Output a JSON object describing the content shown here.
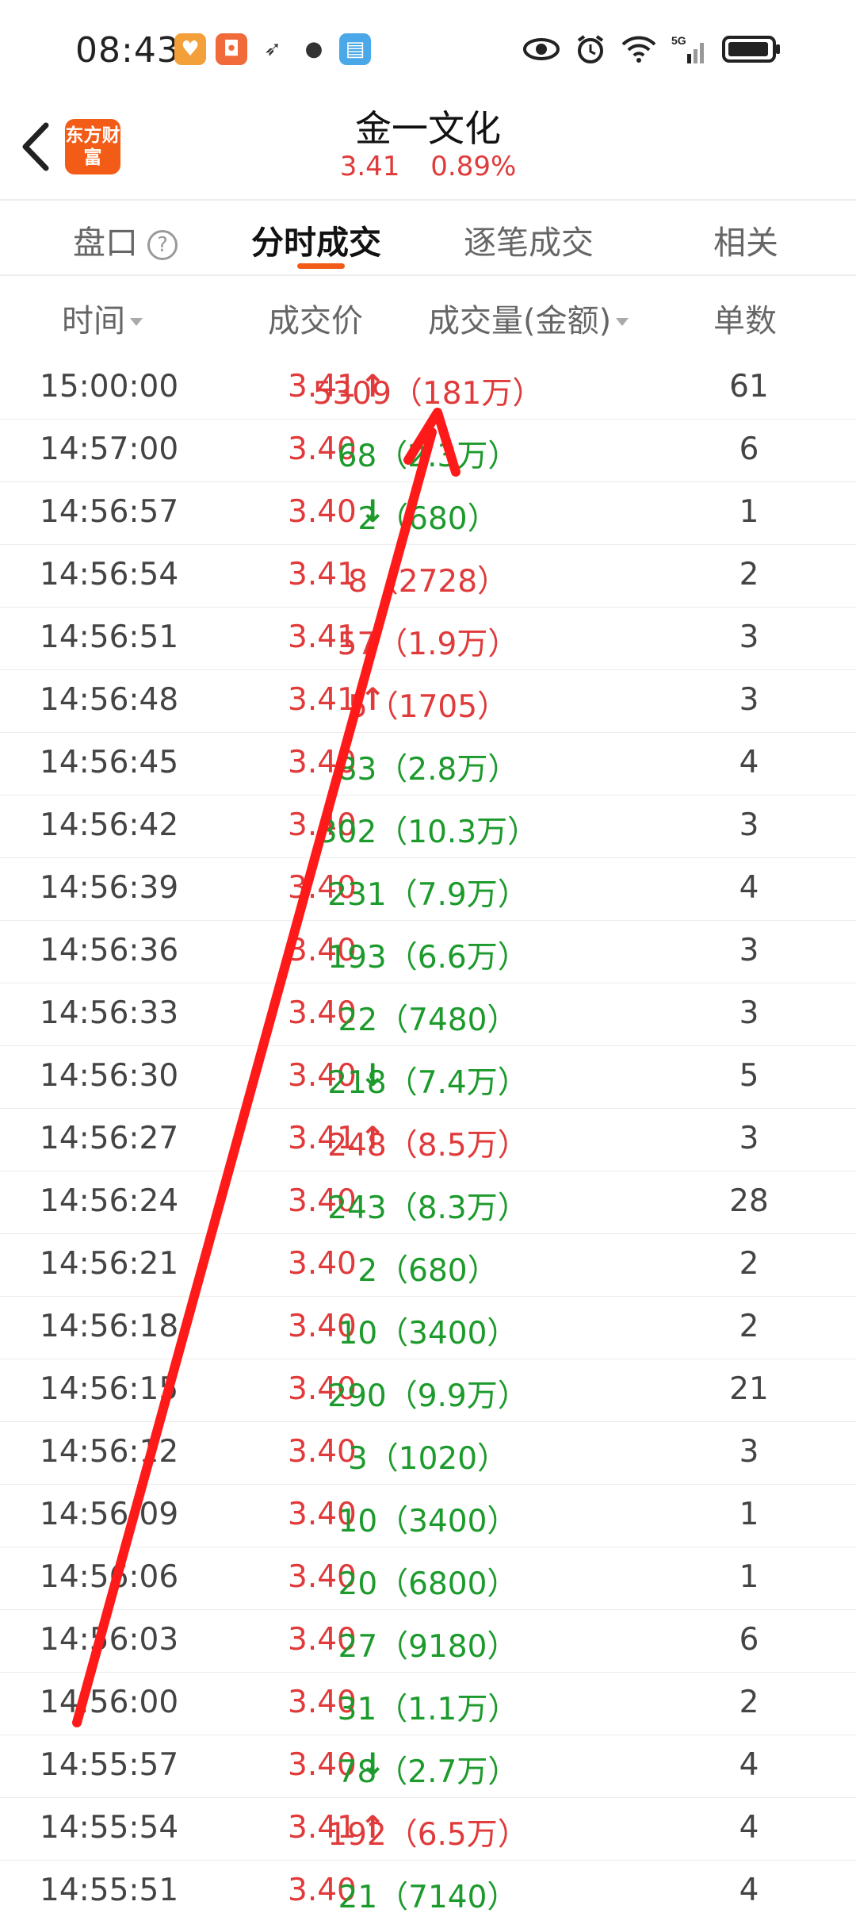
{
  "status_bar": {
    "time": "08:43",
    "network": "5G"
  },
  "header": {
    "title": "金一文化",
    "logo_text": "东方财富",
    "price": "3.41",
    "change_pct": "0.89%"
  },
  "tabs": [
    {
      "label": "盘口",
      "active": false
    },
    {
      "label": "分时成交",
      "active": true
    },
    {
      "label": "逐笔成交",
      "active": false
    },
    {
      "label": "相关",
      "active": false
    }
  ],
  "columns": {
    "time": "时间",
    "price": "成交价",
    "volume": "成交量(金额)",
    "count": "单数"
  },
  "colors": {
    "up": "#e03a3a",
    "down": "#1c9a2c",
    "brand": "#f25c17"
  },
  "rows": [
    {
      "time": "15:00:00",
      "price": "3.41",
      "arrow": "↑",
      "volume": "5309（181万）",
      "vol_color": "red",
      "count": "61"
    },
    {
      "time": "14:57:00",
      "price": "3.40",
      "arrow": "",
      "volume": "68（2.3万）",
      "vol_color": "green",
      "count": "6"
    },
    {
      "time": "14:56:57",
      "price": "3.40",
      "arrow": "↓",
      "volume": "2（680）",
      "vol_color": "green",
      "count": "1"
    },
    {
      "time": "14:56:54",
      "price": "3.41",
      "arrow": "",
      "volume": "8（2728）",
      "vol_color": "red",
      "count": "2"
    },
    {
      "time": "14:56:51",
      "price": "3.41",
      "arrow": "",
      "volume": "57（1.9万）",
      "vol_color": "red",
      "count": "3"
    },
    {
      "time": "14:56:48",
      "price": "3.41",
      "arrow": "↑",
      "volume": "5（1705）",
      "vol_color": "red",
      "count": "3"
    },
    {
      "time": "14:56:45",
      "price": "3.40",
      "arrow": "",
      "volume": "83（2.8万）",
      "vol_color": "green",
      "count": "4"
    },
    {
      "time": "14:56:42",
      "price": "3.40",
      "arrow": "",
      "volume": "302（10.3万）",
      "vol_color": "green",
      "count": "3"
    },
    {
      "time": "14:56:39",
      "price": "3.40",
      "arrow": "",
      "volume": "231（7.9万）",
      "vol_color": "green",
      "count": "4"
    },
    {
      "time": "14:56:36",
      "price": "3.40",
      "arrow": "",
      "volume": "193（6.6万）",
      "vol_color": "green",
      "count": "3"
    },
    {
      "time": "14:56:33",
      "price": "3.40",
      "arrow": "",
      "volume": "22（7480）",
      "vol_color": "green",
      "count": "3"
    },
    {
      "time": "14:56:30",
      "price": "3.40",
      "arrow": "↓",
      "volume": "218（7.4万）",
      "vol_color": "green",
      "count": "5"
    },
    {
      "time": "14:56:27",
      "price": "3.41",
      "arrow": "↑",
      "volume": "248（8.5万）",
      "vol_color": "red",
      "count": "3"
    },
    {
      "time": "14:56:24",
      "price": "3.40",
      "arrow": "",
      "volume": "243（8.3万）",
      "vol_color": "green",
      "count": "28"
    },
    {
      "time": "14:56:21",
      "price": "3.40",
      "arrow": "",
      "volume": "2（680）",
      "vol_color": "green",
      "count": "2"
    },
    {
      "time": "14:56:18",
      "price": "3.40",
      "arrow": "",
      "volume": "10（3400）",
      "vol_color": "green",
      "count": "2"
    },
    {
      "time": "14:56:15",
      "price": "3.40",
      "arrow": "",
      "volume": "290（9.9万）",
      "vol_color": "green",
      "count": "21"
    },
    {
      "time": "14:56:12",
      "price": "3.40",
      "arrow": "",
      "volume": "3（1020）",
      "vol_color": "green",
      "count": "3"
    },
    {
      "time": "14:56:09",
      "price": "3.40",
      "arrow": "",
      "volume": "10（3400）",
      "vol_color": "green",
      "count": "1"
    },
    {
      "time": "14:56:06",
      "price": "3.40",
      "arrow": "",
      "volume": "20（6800）",
      "vol_color": "green",
      "count": "1"
    },
    {
      "time": "14:56:03",
      "price": "3.40",
      "arrow": "",
      "volume": "27（9180）",
      "vol_color": "green",
      "count": "6"
    },
    {
      "time": "14:56:00",
      "price": "3.40",
      "arrow": "",
      "volume": "31（1.1万）",
      "vol_color": "green",
      "count": "2"
    },
    {
      "time": "14:55:57",
      "price": "3.40",
      "arrow": "↓",
      "volume": "78（2.7万）",
      "vol_color": "green",
      "count": "4"
    },
    {
      "time": "14:55:54",
      "price": "3.41",
      "arrow": "↑",
      "volume": "192（6.5万）",
      "vol_color": "red",
      "count": "4"
    },
    {
      "time": "14:55:51",
      "price": "3.40",
      "arrow": "",
      "volume": "21（7140）",
      "vol_color": "green",
      "count": "4"
    }
  ]
}
